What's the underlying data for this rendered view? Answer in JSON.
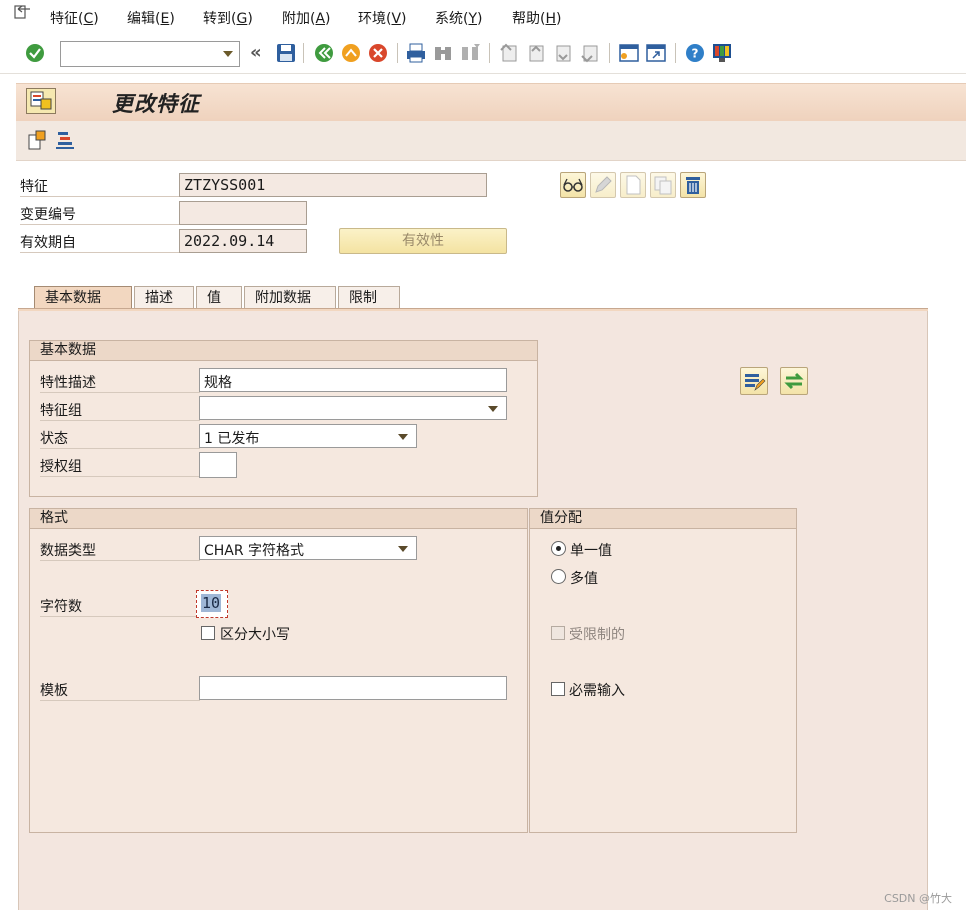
{
  "menu": {
    "items": [
      {
        "label": "特征",
        "key": "C"
      },
      {
        "label": "编辑",
        "key": "E"
      },
      {
        "label": "转到",
        "key": "G"
      },
      {
        "label": "附加",
        "key": "A"
      },
      {
        "label": "环境",
        "key": "V"
      },
      {
        "label": "系统",
        "key": "Y"
      },
      {
        "label": "帮助",
        "key": "H"
      }
    ]
  },
  "toolbar": {
    "command_value": ""
  },
  "title": {
    "text": "更改特征"
  },
  "header": {
    "characteristic_label": "特征",
    "characteristic_value": "ZTZYSS001",
    "change_number_label": "变更编号",
    "change_number_value": "",
    "valid_from_label": "有效期自",
    "valid_from_value": "2022.09.14",
    "validity_button": "有效性"
  },
  "tabs": [
    {
      "label": "基本数据",
      "active": true
    },
    {
      "label": "描述",
      "active": false
    },
    {
      "label": "值",
      "active": false
    },
    {
      "label": "附加数据",
      "active": false
    },
    {
      "label": "限制",
      "active": false
    }
  ],
  "basic_data": {
    "title": "基本数据",
    "description_label": "特性描述",
    "description_value": "规格",
    "char_group_label": "特征组",
    "char_group_value": "",
    "status_label": "状态",
    "status_value": "1 已发布",
    "auth_group_label": "授权组",
    "auth_group_value": ""
  },
  "format": {
    "title": "格式",
    "data_type_label": "数据类型",
    "data_type_value": "CHAR 字符格式",
    "num_chars_label": "字符数",
    "num_chars_value": "10",
    "case_sensitive_label": "区分大小写",
    "template_label": "模板",
    "template_value": ""
  },
  "value_assignment": {
    "title": "值分配",
    "single_value_label": "单一值",
    "multiple_values_label": "多值",
    "restricted_label": "受限制的",
    "entry_required_label": "必需输入",
    "selected": "single"
  },
  "watermark": "CSDN @竹大"
}
